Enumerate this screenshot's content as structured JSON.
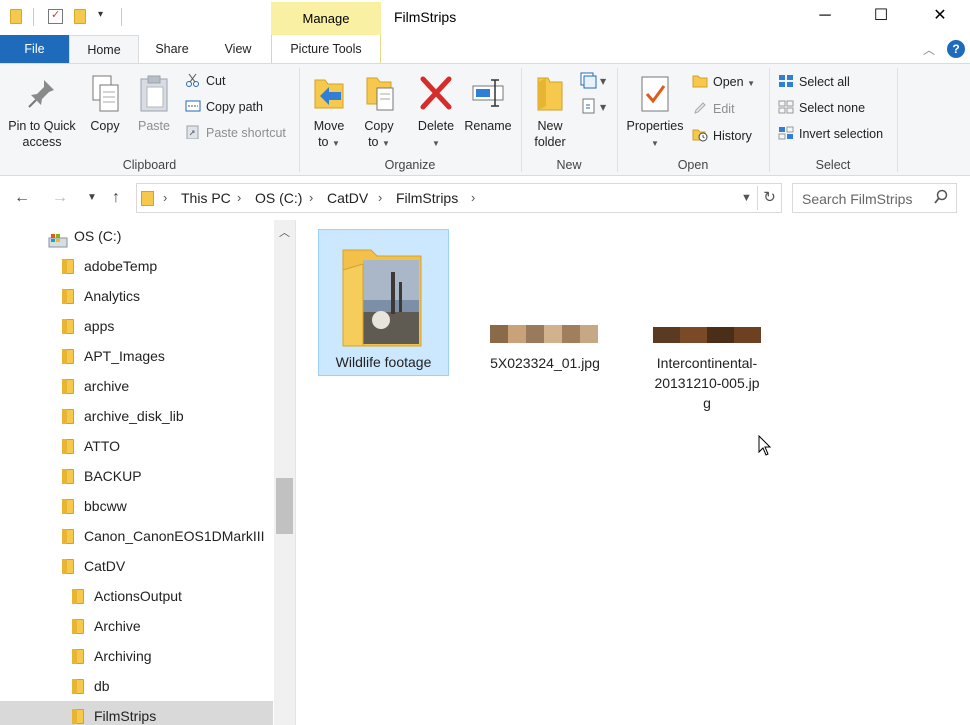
{
  "window": {
    "title": "FilmStrips",
    "context_tab": "Manage",
    "controls": {
      "minimize": "─",
      "maximize": "☐",
      "close": "✕"
    }
  },
  "ribbon_tabs": [
    "File",
    "Home",
    "Share",
    "View",
    "Picture Tools"
  ],
  "ribbon": {
    "clipboard": {
      "label": "Clipboard",
      "pin_line1": "Pin to Quick",
      "pin_line2": "access",
      "copy": "Copy",
      "paste": "Paste",
      "cut": "Cut",
      "copy_path": "Copy path",
      "paste_shortcut": "Paste shortcut"
    },
    "organize": {
      "label": "Organize",
      "move_line1": "Move",
      "move_line2": "to",
      "copy_line1": "Copy",
      "copy_line2": "to",
      "delete": "Delete",
      "rename": "Rename"
    },
    "new": {
      "label": "New",
      "folder_line1": "New",
      "folder_line2": "folder"
    },
    "open": {
      "label": "Open",
      "properties": "Properties",
      "open": "Open",
      "edit": "Edit",
      "history": "History"
    },
    "select": {
      "label": "Select",
      "select_all": "Select all",
      "select_none": "Select none",
      "invert": "Invert selection"
    }
  },
  "address": {
    "crumbs": [
      "This PC",
      "OS (C:)",
      "CatDV",
      "FilmStrips"
    ],
    "search_placeholder": "Search FilmStrips"
  },
  "nav_tree": {
    "drive": "OS (C:)",
    "items": [
      {
        "label": "adobeTemp"
      },
      {
        "label": "Analytics"
      },
      {
        "label": "apps"
      },
      {
        "label": "APT_Images"
      },
      {
        "label": "archive"
      },
      {
        "label": "archive_disk_lib"
      },
      {
        "label": "ATTO"
      },
      {
        "label": "BACKUP"
      },
      {
        "label": "bbcww"
      },
      {
        "label": "Canon_CanonEOS1DMarkIII"
      },
      {
        "label": "CatDV"
      },
      {
        "label": "ActionsOutput"
      },
      {
        "label": "Archive"
      },
      {
        "label": "Archiving"
      },
      {
        "label": "db"
      },
      {
        "label": "FilmStrips"
      }
    ]
  },
  "files": [
    {
      "name": "Wildlife footage",
      "type": "folder",
      "selected": true
    },
    {
      "name": "5X023324_01.jpg",
      "type": "image"
    },
    {
      "name_line1": "Intercontinental-",
      "name_line2": "20131210-005.jp",
      "name_line3": "g",
      "type": "image"
    }
  ],
  "colors": {
    "file_tab": "#1f6bbb",
    "manage_tab": "#f9f0a3",
    "selection": "#cce8ff",
    "folder": "#f6c84b"
  }
}
